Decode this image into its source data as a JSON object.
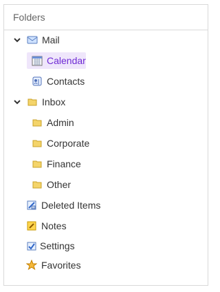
{
  "panel": {
    "title": "Folders"
  },
  "tree": {
    "items": [
      {
        "label": "Mail"
      },
      {
        "label": "Calendar"
      },
      {
        "label": "Contacts"
      },
      {
        "label": "Inbox"
      },
      {
        "label": "Admin"
      },
      {
        "label": "Corporate"
      },
      {
        "label": "Finance"
      },
      {
        "label": "Other"
      },
      {
        "label": "Deleted Items"
      },
      {
        "label": "Notes"
      },
      {
        "label": "Settings"
      },
      {
        "label": "Favorites"
      }
    ],
    "selected": "Calendar"
  },
  "colors": {
    "selected_bg": "#efe6fb",
    "selected_text": "#6f2bd4",
    "border": "#d9d9d9"
  },
  "icons": [
    "chevron-down-icon",
    "mail-icon",
    "calendar-icon",
    "contacts-icon",
    "folder-icon",
    "deleted-items-icon",
    "notes-icon",
    "settings-icon",
    "star-icon"
  ]
}
